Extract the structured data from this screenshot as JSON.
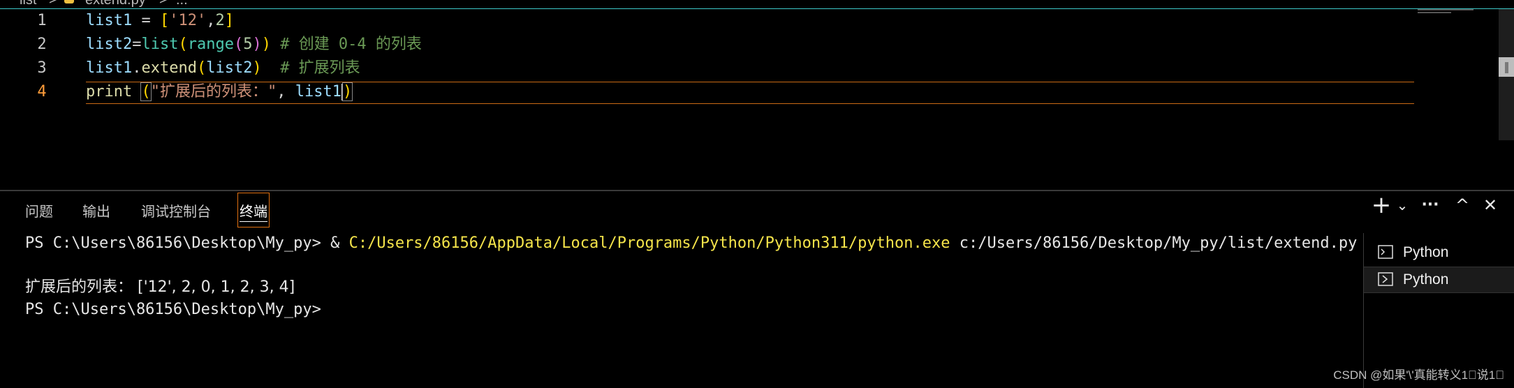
{
  "breadcrumb": {
    "folder": "list",
    "separator": ">",
    "file": "extend.py",
    "more": "..."
  },
  "editor": {
    "lines": [
      {
        "num": "1"
      },
      {
        "num": "2"
      },
      {
        "num": "3"
      },
      {
        "num": "4"
      }
    ],
    "code": {
      "l1": {
        "a": "list1",
        "b": " = ",
        "c": "[",
        "d": "'12'",
        "e": ",",
        "f": "2",
        "g": "]"
      },
      "l2": {
        "a": "list2",
        "b": "=",
        "c": "list",
        "d": "(",
        "e": "range",
        "f": "(",
        "g": "5",
        "h": ")",
        "i": ")",
        "j": " # 创建 0-4 的列表"
      },
      "l3": {
        "a": "list1",
        "b": ".",
        "c": "extend",
        "d": "(",
        "e": "list2",
        "f": ")",
        "g": "  # 扩展列表"
      },
      "l4": {
        "a": "print",
        "b": " ",
        "c": "(",
        "d": "\"扩展后的列表：\"",
        "e": ", ",
        "f": "list1",
        "g": ")"
      }
    },
    "active_line": 4
  },
  "panel": {
    "tabs": [
      {
        "label": "问题"
      },
      {
        "label": "输出"
      },
      {
        "label": "调试控制台"
      },
      {
        "label": "终端"
      }
    ],
    "active_tab": "终端",
    "actions": {
      "new": "+",
      "dropdown": "⌄",
      "more": "···",
      "maximize": "^",
      "close": "✕"
    }
  },
  "terminal": {
    "line1_prompt": "PS C:\\Users\\86156\\Desktop\\My_py> ",
    "line1_amp": "& ",
    "line1_exe": "C:/Users/86156/AppData/Local/Programs/Python/Python311/python.exe",
    "line1_arg": " c:/Users/86156/Desktop/My_py/list/extend.py",
    "line2": "扩展后的列表： ['12', 2, 0, 1, 2, 3, 4]",
    "line3": "PS C:\\Users\\86156\\Desktop\\My_py>"
  },
  "terminal_list": [
    {
      "label": "Python"
    },
    {
      "label": "Python"
    }
  ],
  "watermark": "CSDN @如果'\\'真能转义1\u0000说1\u0000",
  "colors": {
    "accent_border": "#e07010",
    "exe_path": "#f5e44a",
    "breadcrumb_border": "#3dc9c9"
  }
}
